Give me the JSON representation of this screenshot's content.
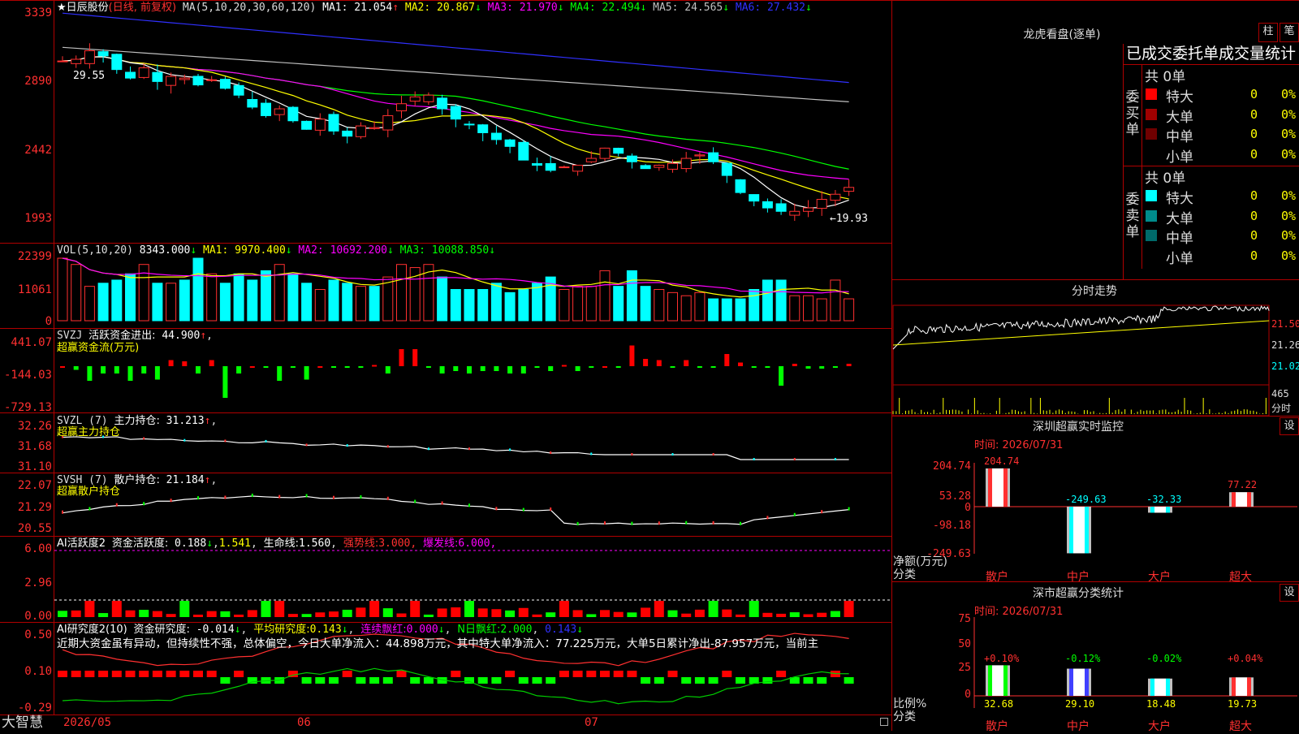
{
  "stock": {
    "star": "★",
    "name": "日辰股份",
    "mode": "(日线, 前复权)",
    "ma_label": "MA(5,10,20,30,60,120)",
    "ma": [
      {
        "n": "MA1:",
        "v": "21.054",
        "a": "↑",
        "c": "#ffffff"
      },
      {
        "n": "MA2:",
        "v": "20.867",
        "a": "↓",
        "c": "#ffff00"
      },
      {
        "n": "MA3:",
        "v": "21.970",
        "a": "↓",
        "c": "#ff00ff"
      },
      {
        "n": "MA4:",
        "v": "22.494",
        "a": "↓",
        "c": "#00ff00"
      },
      {
        "n": "MA5:",
        "v": "24.565",
        "a": "↓",
        "c": "#c0c0c0"
      },
      {
        "n": "MA6:",
        "v": "27.432",
        "a": "↓",
        "c": "#3030ff"
      }
    ],
    "price_axis": [
      "3339",
      "2890",
      "2442",
      "1993"
    ],
    "high_mark": "29.55",
    "low_mark": "←19.93"
  },
  "vol": {
    "label": "VOL(5,10,20)",
    "val": "8343.000",
    "a": "↓",
    "ma": [
      {
        "n": "MA1:",
        "v": "9970.400",
        "a": "↓",
        "c": "#ffff00"
      },
      {
        "n": "MA2:",
        "v": "10692.200",
        "a": "↓",
        "c": "#ff00ff"
      },
      {
        "n": "MA3:",
        "v": "10088.850",
        "a": "↓",
        "c": "#00ff00"
      }
    ],
    "axis": [
      "22399",
      "11061",
      "0"
    ]
  },
  "svzj": {
    "label": "SVZJ",
    "t1": "活跃资金进出:",
    "v1": "44.900",
    "a1": "↑",
    "t2": "超赢资金流(万元)",
    "axis": [
      "441.07",
      "-144.03",
      "-729.13"
    ]
  },
  "svzl": {
    "label": "SVZL (7)",
    "t1": "主力持仓:",
    "v1": "31.213",
    "a1": "↑",
    "t2": "超赢主力持仓",
    "axis": [
      "32.26",
      "31.68",
      "31.10"
    ]
  },
  "svsh": {
    "label": "SVSH (7)",
    "t1": "散户持仓:",
    "v1": "21.184",
    "a1": "↑",
    "t2": "超赢散户持仓",
    "axis": [
      "22.07",
      "21.29",
      "20.55"
    ]
  },
  "ai1": {
    "label": "AI活跃度2",
    "t1": "资金活跃度:",
    "v1": "0.188",
    "a1": "↓",
    "v2": "1.541",
    "t3": "生命线:",
    "v3": "1.560",
    "t4": "强势线:",
    "v4": "3.000",
    "t5": "爆发线:",
    "v5": "6.000",
    "axis": [
      "6.00",
      "2.96",
      "0.00"
    ]
  },
  "ai2": {
    "label": "AI研究度2(10)",
    "t1": "资金研究度:",
    "v1": "-0.014",
    "a1": "↓",
    "t2": "平均研究度:",
    "v2": "0.143",
    "a2": "↓",
    "t3": "连续飘红:",
    "v3": "0.000",
    "a3": "↓",
    "t4": "N日飘红:",
    "v4": "2.000",
    "v5": "0.143",
    "a5": "↓",
    "note": "近期大资金虽有异动，但持续性不强，总体偏空，今日大单净流入：44.898万元，其中特大单净流入：77.225万元，大单5日累计净出-87.957万元，当前主",
    "axis": [
      "0.50",
      "0.10",
      "-0.29"
    ]
  },
  "bottom": {
    "brand": "大智慧",
    "d1": "2026/05",
    "d2": "06",
    "d3": "07"
  },
  "lhb": {
    "title": "龙虎看盘(逐单)",
    "tab1": "柱",
    "tab2": "笔",
    "subtitle": "已成交委托单成交量统计",
    "buy_group": "委买单",
    "sell_group": "委卖单",
    "buy_total": "共 0单",
    "sell_total": "共 0单",
    "buy_rows": [
      {
        "label": "特大",
        "cnt": "0",
        "pct": "0%",
        "color": "#ff0000"
      },
      {
        "label": "大单",
        "cnt": "0",
        "pct": "0%",
        "color": "#a00000"
      },
      {
        "label": "中单",
        "cnt": "0",
        "pct": "0%",
        "color": "#700000"
      },
      {
        "label": "小单",
        "cnt": "0",
        "pct": "0%",
        "color": "#000000"
      }
    ],
    "sell_rows": [
      {
        "label": "特大",
        "cnt": "0",
        "pct": "0%",
        "color": "#00ffff"
      },
      {
        "label": "大单",
        "cnt": "0",
        "pct": "0%",
        "color": "#008c8c"
      },
      {
        "label": "中单",
        "cnt": "0",
        "pct": "0%",
        "color": "#006a6a"
      },
      {
        "label": "小单",
        "cnt": "0",
        "pct": "0%",
        "color": "#000000"
      }
    ]
  },
  "fenshi": {
    "title": "分时走势",
    "axis": [
      "21.50",
      "21.26",
      "21.02"
    ],
    "vol_label": "465",
    "unit": "分时"
  },
  "sz_monitor": {
    "title": "深圳超赢实时监控",
    "btn": "设",
    "time": "时间: 2026/07/31",
    "axis": [
      "204.74",
      "53.28",
      "0",
      "-98.18",
      "-249.63"
    ],
    "ylab1": "净额(万元)",
    "ylab2": "分类",
    "bars": [
      {
        "cat": "散户",
        "val": "204.74",
        "num": 204.74,
        "color": "#ff3030"
      },
      {
        "cat": "中户",
        "val": "-249.63",
        "num": -249.63,
        "color": "#00ffff"
      },
      {
        "cat": "大户",
        "val": "-32.33",
        "num": -32.33,
        "color": "#00ffff"
      },
      {
        "cat": "超大",
        "val": "77.22",
        "num": 77.22,
        "color": "#ff3030"
      }
    ]
  },
  "cls_stat": {
    "title": "深市超赢分类统计",
    "btn": "设",
    "time": "时间: 2026/07/31",
    "axis": [
      "75",
      "50",
      "25",
      "0"
    ],
    "ylab1": "比例%",
    "ylab2": "分类",
    "bars": [
      {
        "cat": "散户",
        "pct": "+0.10%",
        "val": "32.68",
        "num": 32.68,
        "color": "#00ff00"
      },
      {
        "cat": "中户",
        "pct": "-0.12%",
        "val": "29.10",
        "num": 29.1,
        "color": "#4040ff"
      },
      {
        "cat": "大户",
        "pct": "-0.02%",
        "val": "18.48",
        "num": 18.48,
        "color": "#00ffff"
      },
      {
        "cat": "超大",
        "pct": "+0.04%",
        "val": "19.73",
        "num": 19.73,
        "color": "#ff3030"
      }
    ]
  }
}
